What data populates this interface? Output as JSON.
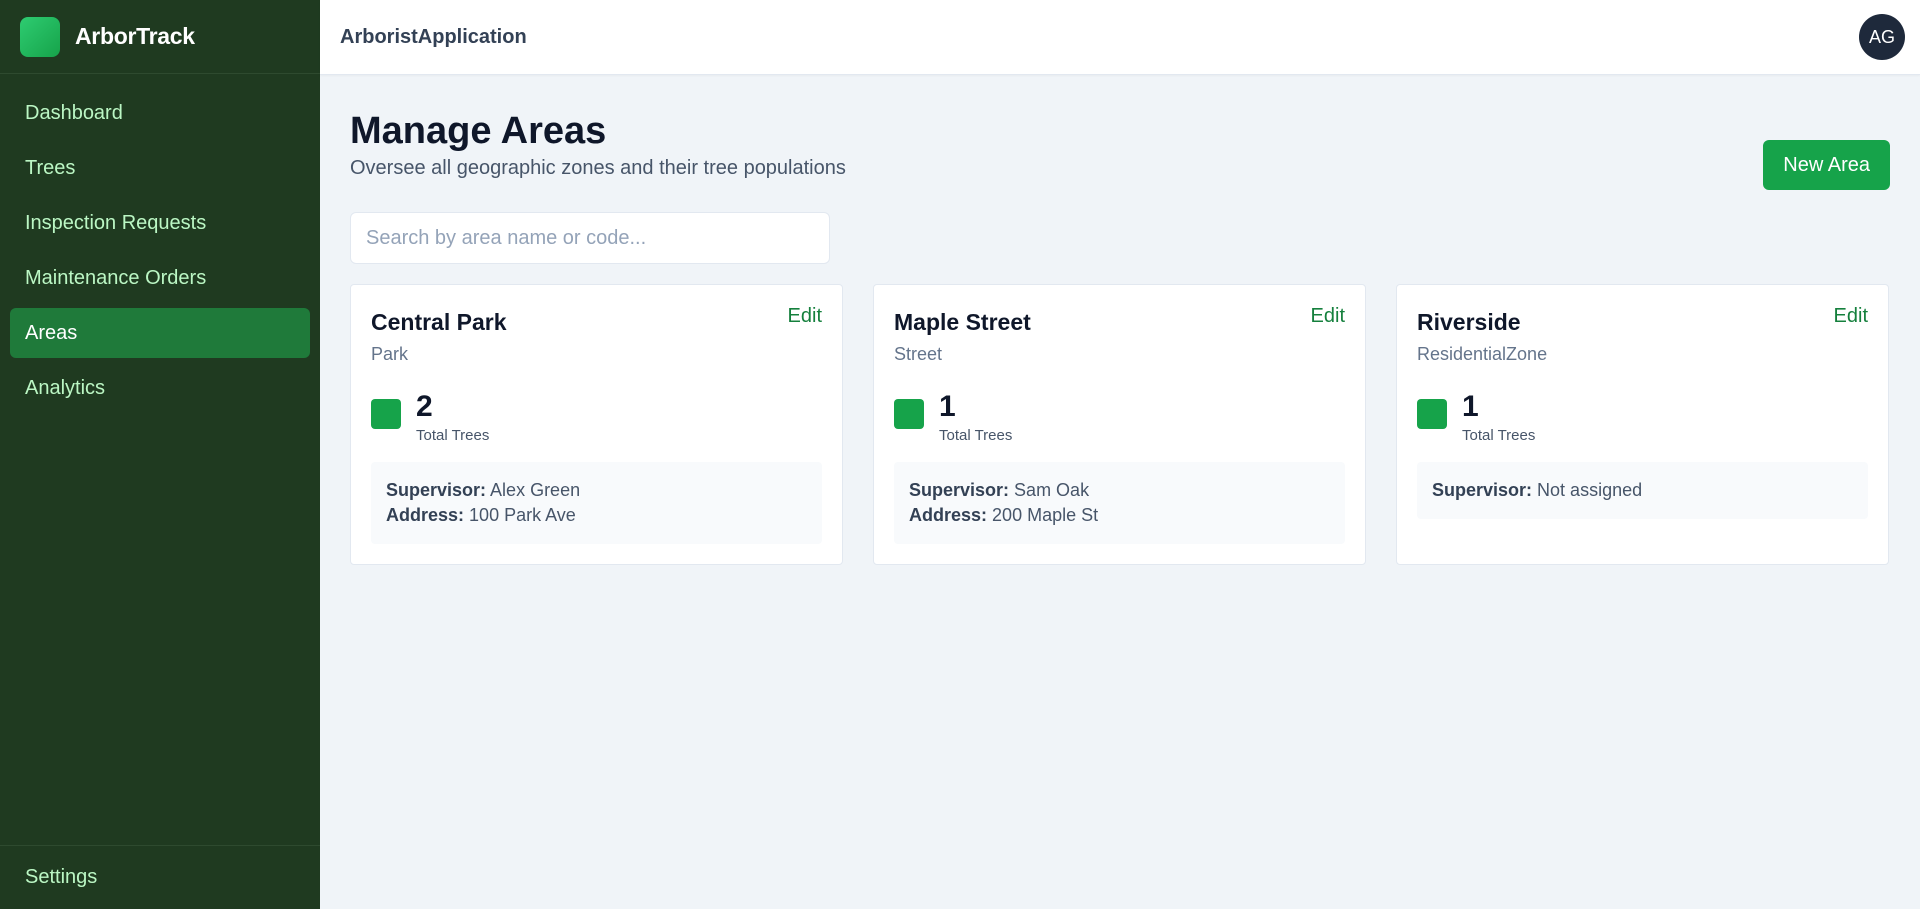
{
  "brand": {
    "name": "ArborTrack"
  },
  "sidebar": {
    "items": [
      {
        "label": "Dashboard",
        "active": false
      },
      {
        "label": "Trees",
        "active": false
      },
      {
        "label": "Inspection Requests",
        "active": false
      },
      {
        "label": "Maintenance Orders",
        "active": false
      },
      {
        "label": "Areas",
        "active": true
      },
      {
        "label": "Analytics",
        "active": false
      }
    ],
    "settings_label": "Settings"
  },
  "topbar": {
    "app_name": "ArboristApplication",
    "avatar_initials": "AG"
  },
  "page": {
    "title": "Manage Areas",
    "subtitle": "Oversee all geographic zones and their tree populations",
    "new_button": "New Area",
    "search_placeholder": "Search by area name or code..."
  },
  "cards": [
    {
      "name": "Central Park",
      "type": "Park",
      "edit_label": "Edit",
      "tree_count": "2",
      "tree_label": "Total Trees",
      "supervisor_label": "Supervisor:",
      "supervisor": "Alex Green",
      "address_label": "Address:",
      "address": "100 Park Ave"
    },
    {
      "name": "Maple Street",
      "type": "Street",
      "edit_label": "Edit",
      "tree_count": "1",
      "tree_label": "Total Trees",
      "supervisor_label": "Supervisor:",
      "supervisor": "Sam Oak",
      "address_label": "Address:",
      "address": "200 Maple St"
    },
    {
      "name": "Riverside",
      "type": "ResidentialZone",
      "edit_label": "Edit",
      "tree_count": "1",
      "tree_label": "Total Trees",
      "supervisor_label": "Supervisor:",
      "supervisor": "Not assigned"
    }
  ],
  "colors": {
    "sidebar_bg": "#1f3a20",
    "accent": "#16a34a",
    "nav_active": "#1f7a3a"
  }
}
